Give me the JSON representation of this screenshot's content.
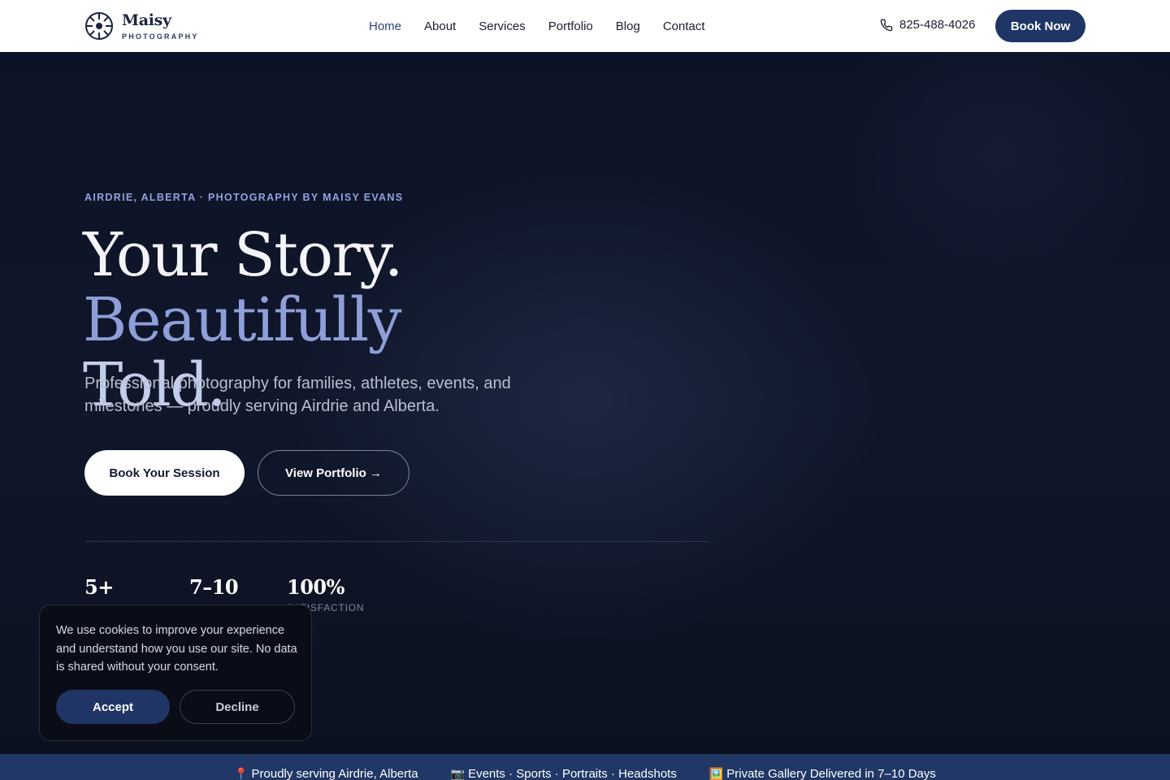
{
  "brand": {
    "name": "Maisy",
    "tagline": "PHOTOGRAPHY"
  },
  "nav": {
    "items": [
      {
        "label": "Home",
        "active": true
      },
      {
        "label": "About"
      },
      {
        "label": "Services"
      },
      {
        "label": "Portfolio"
      },
      {
        "label": "Blog"
      },
      {
        "label": "Contact"
      }
    ]
  },
  "header": {
    "phone": "825-488-4026",
    "book_now": "Book Now"
  },
  "hero": {
    "eyebrow": "AIRDRIE, ALBERTA · PHOTOGRAPHY BY MAISY EVANS",
    "headline_part1": "Your Story.",
    "headline_part2": "Beautifully",
    "headline_part3": "Told.",
    "subtitle": "Professional photography for families, athletes, events, and milestones — proudly serving Airdrie and Alberta.",
    "primary_cta": "Book Your Session",
    "secondary_cta": "View Portfolio →"
  },
  "stats": [
    {
      "value": "5+",
      "label": ""
    },
    {
      "value": "7–10",
      "label": ""
    },
    {
      "value": "100%",
      "label": "SATISFACTION"
    }
  ],
  "cookie": {
    "text": "We use cookies to improve your experience and understand how you use our site. No data is shared without your consent.",
    "accept": "Accept",
    "decline": "Decline"
  },
  "ribbon": [
    {
      "icon": "📍",
      "icon_name": "pin-icon",
      "text": "Proudly serving Airdrie, Alberta"
    },
    {
      "icon": "📷",
      "icon_name": "camera-icon",
      "text": "Events · Sports · Portraits · Headshots"
    },
    {
      "icon": "🖼️",
      "icon_name": "gallery-icon",
      "text": "Private Gallery Delivered in 7–10 Days"
    }
  ],
  "colors": {
    "brand_navy": "#1f3566",
    "accent": "#8e9fd8",
    "hero_bg": "#0d1326"
  }
}
